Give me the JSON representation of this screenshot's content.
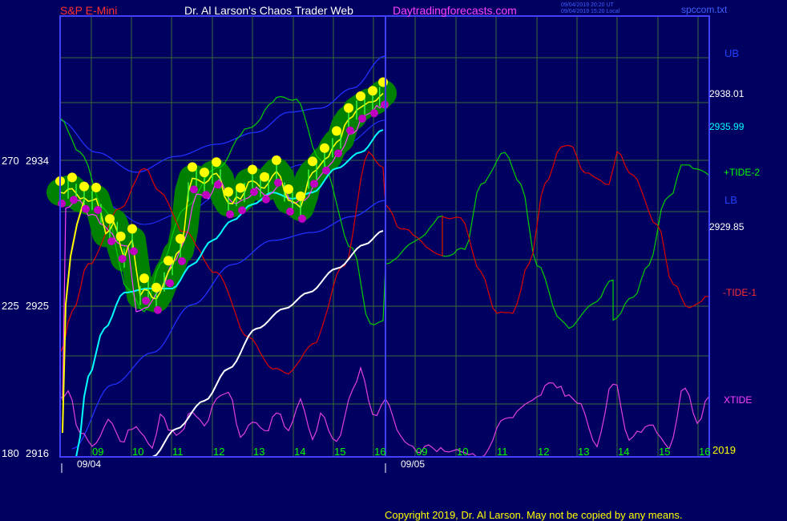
{
  "header": {
    "symbol": "S&P E-Mini",
    "site": "Dr. Al Larson's Chaos Trader Web",
    "url": "Daytradingforecasts.com",
    "time_ut": "09/04/2019 20:20 UT",
    "time_local": "09/04/2019 15:20 Local",
    "file": "spccom.txt"
  },
  "copyright": "Copyright 2019, Dr. Al Larson. May not be copied by any means.",
  "left_axis": [
    {
      "label": "270",
      "price": "2934",
      "value": 2934
    },
    {
      "label": "225",
      "price": "2925",
      "value": 2925
    },
    {
      "label": "180",
      "price": "2916",
      "value": 2916
    }
  ],
  "right_labels": {
    "ub": "UB",
    "price1": "2938.01",
    "price2": "2935.99",
    "tide2": "+TIDE-2",
    "lb": "LB",
    "price3": "2929.85",
    "tide1": "-TIDE-1",
    "xtide": "XTIDE",
    "year": "2019"
  },
  "x_axis": {
    "hours_day1": [
      "09",
      "10",
      "11",
      "12",
      "13",
      "14",
      "15",
      "16"
    ],
    "hours_day2": [
      "09",
      "10",
      "11",
      "12",
      "13",
      "14",
      "15",
      "16"
    ],
    "date1": "09/04",
    "date2": "09/05"
  },
  "chart_data": {
    "type": "line",
    "title": "S&P E-Mini",
    "xlabel": "",
    "ylabel": "",
    "ylim": [
      2916,
      2943
    ],
    "x": [
      "09/04 08:30",
      "09",
      "10",
      "11",
      "12",
      "13",
      "14",
      "15",
      "16"
    ],
    "series": [
      {
        "name": "price",
        "values": [
          2932,
          2932,
          2924,
          2927,
          2932,
          2933,
          2931,
          2937,
          2939
        ],
        "color": "#ffff00"
      },
      {
        "name": "cyan average",
        "values": [
          2917,
          2922,
          2927,
          2929,
          2931,
          2932,
          2932,
          2934,
          2936
        ],
        "color": "#00ffff"
      },
      {
        "name": "white average",
        "values": [
          null,
          null,
          2916,
          2919,
          2922,
          2924,
          2926,
          2928,
          2930
        ],
        "color": "#ffffff"
      },
      {
        "name": "+TIDE-2",
        "values": [
          2937,
          2932,
          2925,
          2929,
          2936,
          2940,
          2938,
          2932,
          2925
        ],
        "color": "#00ff00"
      },
      {
        "name": "-TIDE-1",
        "values": [
          2923,
          2929,
          2934,
          2929,
          2923,
          2919,
          2924,
          2932,
          2936
        ],
        "color": "#ff0000"
      },
      {
        "name": "XTIDE",
        "values": [
          2921,
          2918,
          2917,
          2920,
          2919,
          2918,
          2920,
          2918,
          2920
        ],
        "color": "#ff40ff"
      }
    ],
    "colors": {
      "background": "#000060",
      "grid": "#3a6a3a",
      "frame": "#4040ff",
      "halo": "#008000",
      "dot_high": "#ffff00",
      "dot_low": "#c000c0"
    }
  }
}
